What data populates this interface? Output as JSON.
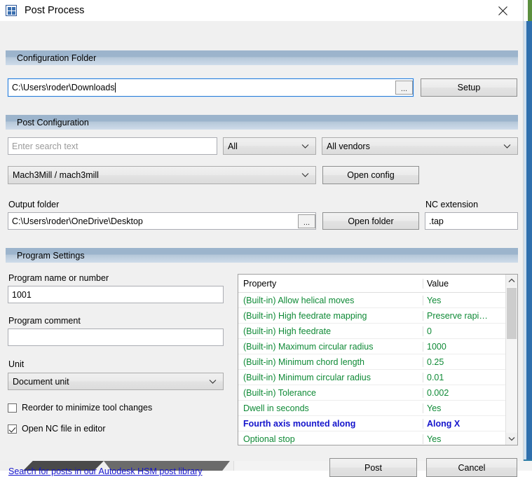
{
  "window": {
    "title": "Post Process",
    "icon": "post-process-icon",
    "close_icon": "close-icon"
  },
  "sections": {
    "configuration_folder": {
      "header": "Configuration Folder",
      "path_value": "C:\\Users\\roder\\Downloads",
      "browse_label": "...",
      "setup_button": "Setup"
    },
    "post_configuration": {
      "header": "Post Configuration",
      "search_placeholder": "Enter search text",
      "filter_type_value": "All",
      "filter_vendor_value": "All vendors",
      "post_value": "Mach3Mill / mach3mill",
      "open_config_button": "Open config",
      "output_folder_label": "Output folder",
      "output_folder_value": "C:\\Users\\roder\\OneDrive\\Desktop",
      "output_browse_label": "...",
      "open_folder_button": "Open folder",
      "nc_extension_label": "NC extension",
      "nc_extension_value": ".tap"
    },
    "program_settings": {
      "header": "Program Settings",
      "program_name_label": "Program name or number",
      "program_name_value": "1001",
      "program_comment_label": "Program comment",
      "program_comment_value": "",
      "unit_label": "Unit",
      "unit_value": "Document unit",
      "reorder_checkbox_label": "Reorder to minimize tool changes",
      "reorder_checked": false,
      "open_nc_checkbox_label": "Open NC file in editor",
      "open_nc_checked": true
    }
  },
  "property_grid": {
    "columns": [
      "Property",
      "Value"
    ],
    "rows": [
      {
        "property": "(Built-in) Allow helical moves",
        "value": "Yes",
        "highlight": false
      },
      {
        "property": "(Built-in) High feedrate mapping",
        "value": "Preserve rapi…",
        "highlight": false
      },
      {
        "property": "(Built-in) High feedrate",
        "value": "0",
        "highlight": false
      },
      {
        "property": "(Built-in) Maximum circular radius",
        "value": "1000",
        "highlight": false
      },
      {
        "property": "(Built-in) Minimum chord length",
        "value": "0.25",
        "highlight": false
      },
      {
        "property": "(Built-in) Minimum circular radius",
        "value": "0.01",
        "highlight": false
      },
      {
        "property": "(Built-in) Tolerance",
        "value": "0.002",
        "highlight": false
      },
      {
        "property": "Dwell in seconds",
        "value": "Yes",
        "highlight": false
      },
      {
        "property": "Fourth axis mounted along",
        "value": "Along X",
        "highlight": true
      },
      {
        "property": "Optional stop",
        "value": "Yes",
        "highlight": false
      }
    ],
    "scroll_up_icon": "chevron-up-icon",
    "scroll_down_icon": "chevron-down-icon"
  },
  "footer": {
    "library_link": "Search for posts in our Autodesk HSM post library",
    "post_button": "Post",
    "cancel_button": "Cancel"
  },
  "colors": {
    "group_header": "#9cb4cc",
    "property_text": "#0f8a36",
    "highlight_text": "#1414cc",
    "link": "#1414cc",
    "focus_border": "#2a7bd4"
  }
}
